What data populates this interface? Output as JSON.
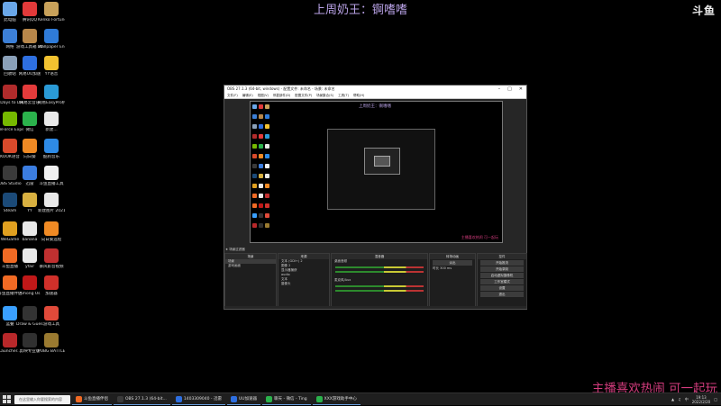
{
  "overlay": {
    "title": "上周奶王：锕嗜嗜",
    "watermark": "斗鱼",
    "bottom_text": "主播喜欢热闹 可一起玩"
  },
  "desktop_icons": [
    {
      "label": "此电脑",
      "color": "#6aa7e8",
      "icon": "computer-icon"
    },
    {
      "label": "腾讯QQ",
      "color": "#e23a3a",
      "icon": "qq-icon"
    },
    {
      "label": "Kenko Fortune",
      "color": "#c9a25a",
      "icon": "app-icon"
    },
    {
      "label": "网络",
      "color": "#3c7fd6",
      "icon": "network-icon"
    },
    {
      "label": "游戏工具箱 2022",
      "color": "#b8874a",
      "icon": "toolbox-icon"
    },
    {
      "label": "Wallpaper Engine",
      "color": "#2f7bd8",
      "icon": "wallpaper-icon"
    },
    {
      "label": "回收站",
      "color": "#8aa0b8",
      "icon": "recycle-bin-icon"
    },
    {
      "label": "网易UU加速",
      "color": "#2e6fe0",
      "icon": "uu-icon"
    },
    {
      "label": "YY语音",
      "color": "#f2c230",
      "icon": "yy-icon"
    },
    {
      "label": "7 Days to Die",
      "color": "#b02b2b",
      "icon": "game-icon"
    },
    {
      "label": "网易云音乐",
      "color": "#e33b3b",
      "icon": "music-icon"
    },
    {
      "label": "网易EasyPro机械",
      "color": "#2a9ad6",
      "icon": "easypro-icon"
    },
    {
      "label": "GeForce Experience",
      "color": "#76b900",
      "icon": "nvidia-icon"
    },
    {
      "label": "微信",
      "color": "#2bb24c",
      "icon": "wechat-icon"
    },
    {
      "label": "新建...",
      "color": "#e8e8e8",
      "icon": "file-icon"
    },
    {
      "label": "KOOK语音",
      "color": "#d84a2b",
      "icon": "kook-icon"
    },
    {
      "label": "向日葵",
      "color": "#f08a24",
      "icon": "sunflower-icon"
    },
    {
      "label": "酷狗音乐",
      "color": "#2e8be6",
      "icon": "kugou-icon"
    },
    {
      "label": "OBS Studio",
      "color": "#3a3a3a",
      "icon": "obs-icon"
    },
    {
      "label": "迅雷",
      "color": "#3b7de0",
      "icon": "xunlei-icon"
    },
    {
      "label": "斗鱼直播工具",
      "color": "#f0f0f0",
      "icon": "douyu-icon"
    },
    {
      "label": "Steam",
      "color": "#1b4a78",
      "icon": "steam-icon"
    },
    {
      "label": "YY",
      "color": "#d8b040",
      "icon": "yy2-icon"
    },
    {
      "label": "新建图片 20211110...",
      "color": "#e8e8e8",
      "icon": "image-icon"
    },
    {
      "label": "WeGame",
      "color": "#e0a020",
      "icon": "wegame-icon"
    },
    {
      "label": "banana",
      "color": "#e8e8e8",
      "icon": "banana-icon"
    },
    {
      "label": "向日葵远程",
      "color": "#f08a24",
      "icon": "remote-icon"
    },
    {
      "label": "斗鱼直播",
      "color": "#f06a24",
      "icon": "douyu-live-icon"
    },
    {
      "label": "yfair",
      "color": "#e8e8e8",
      "icon": "file2-icon"
    },
    {
      "label": "暴风影音视频",
      "color": "#c03030",
      "icon": "video-icon"
    },
    {
      "label": "斗鱼直播伴侣",
      "color": "#f06a24",
      "icon": "companion-icon"
    },
    {
      "label": "Among Us",
      "color": "#c01818",
      "icon": "amongus-icon"
    },
    {
      "label": "加速器",
      "color": "#d0302a",
      "icon": "accelerator-icon"
    },
    {
      "label": "蓝叠",
      "color": "#3aa0ff",
      "icon": "bluestacks-icon"
    },
    {
      "label": "Draw & Guess",
      "color": "#333333",
      "icon": "draw-guess-icon"
    },
    {
      "label": "游戏工具",
      "color": "#e04a3a",
      "icon": "windows-tool-icon"
    },
    {
      "label": "Launcher...",
      "color": "#b8282a",
      "icon": "launcher-icon"
    },
    {
      "label": "剪映专业版",
      "color": "#303030",
      "icon": "capcut-icon"
    },
    {
      "label": "PUBG BATTLEGR...",
      "color": "#9a7a30",
      "icon": "pubg-icon"
    }
  ],
  "obs": {
    "title": "OBS 27.1.3 (64-bit, windows) - 配置文件: 未命名 - 场景: 未命名",
    "menu": [
      "文件(F)",
      "编辑(E)",
      "视图(V)",
      "停靠部件(D)",
      "配置文件(P)",
      "场景集合(S)",
      "工具(T)",
      "帮助(H)"
    ],
    "preview_title": "上周奶王：锕嗜嗜",
    "preview_bottom": "主播喜欢热闹 可一起玩",
    "scene_label": "★ 场景过滤器",
    "docks": {
      "scenes_header": "场景",
      "scenes": [
        "场景",
        "游戏画面"
      ],
      "sources_header": "来源",
      "sources": [
        "文本 (GDI+) 2",
        "图像 2",
        "显示器捕获",
        "audio",
        "文本",
        "摄像头"
      ],
      "mixer_header": "混音器",
      "mixer_tracks": [
        "桌面音频",
        "麦克风/Aux"
      ],
      "transitions_header": "转场动画",
      "transition_value": "淡出",
      "duration_label": "时长",
      "duration_value": "300 ms",
      "controls_header": "控件",
      "controls": [
        "开始推流",
        "开始录制",
        "启动虚拟摄像机",
        "工作室模式",
        "设置",
        "退出"
      ]
    }
  },
  "taskbar": {
    "search_placeholder": "在这里输入你要搜索的内容",
    "apps": [
      {
        "label": "斗鱼直播伴侣",
        "color": "#f06a24"
      },
      {
        "label": "OBS 27.1.3 (64-bit...",
        "color": "#3a3a3a"
      },
      {
        "label": "1403309040 - 迅雷",
        "color": "#2e6fe0"
      },
      {
        "label": "UU加速器",
        "color": "#2e6fe0"
      },
      {
        "label": "聊天 - 微信 - Ting",
        "color": "#2bb24c"
      },
      {
        "label": "XXX游戏助手中心",
        "color": "#2bb24c"
      }
    ],
    "time": "19:13",
    "date": "2022/2/20",
    "lang": "中"
  }
}
